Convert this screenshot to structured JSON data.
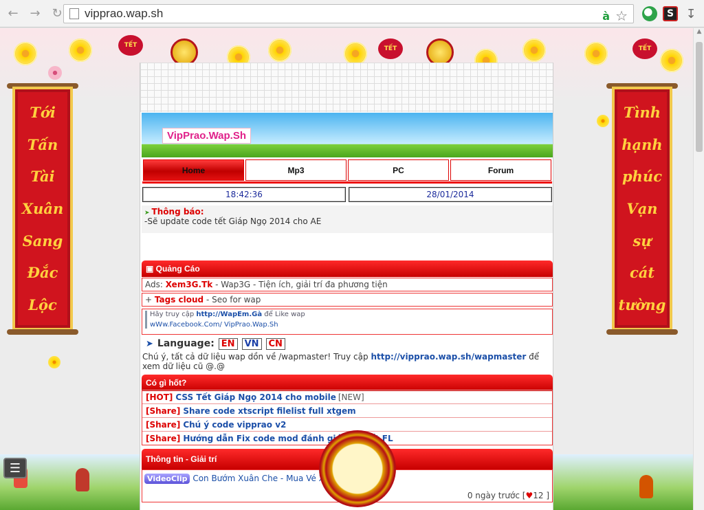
{
  "browser": {
    "url": "vipprao.wap.sh",
    "translate_icon": "à",
    "ext_badge": "S"
  },
  "banners": {
    "left": [
      "Tới",
      "Tấn",
      "Tài",
      "Xuân",
      "Sang",
      "Đắc",
      "Lộc"
    ],
    "right": [
      "Tình",
      "hạnh",
      "phúc",
      "Vạn",
      "sự",
      "cát",
      "tường"
    ]
  },
  "garland_badge": "TẾT",
  "site": {
    "logo": "VipPrao.Wap.Sh",
    "menu": [
      "Home",
      "Mp3",
      "PC",
      "Forum"
    ],
    "time": "18:42:36",
    "date": "28/01/2014",
    "notice": {
      "title": "Thông báo:",
      "text": "-Sẽ update code tết Giáp Ngọ 2014 cho AE"
    },
    "ads": {
      "heading": "Quảng Cáo",
      "prefix": "Ads:",
      "link": "Xem3G.Tk",
      "desc": "- Wap3G - Tiện ích, giải trí đa phương tiện"
    },
    "tags": {
      "prefix": "+",
      "label": "Tags cloud",
      "desc": "- Seo for wap"
    },
    "like": {
      "text1": "Hãy truy cập",
      "link": "http://WapEm.Gà",
      "text2": "để Like wap",
      "fb": "wWw.Facebook.Com/ VipPrao.Wap.Sh"
    },
    "language": {
      "label": "Language:",
      "options": [
        "EN",
        "VN",
        "CN"
      ]
    },
    "info": {
      "pre": "Chú ý, tất cả dữ liệu wap dồn về /wapmaster! Truy cập",
      "link": "http://vipprao.wap.sh/wapmaster",
      "post": "để xem dữ liệu cũ @.@"
    },
    "hot": {
      "heading": "Có gì hốt?",
      "items": [
        {
          "tag": "[HOT]",
          "title": "CSS Tết Giáp Ngọ 2014 cho mobile",
          "extra": "[NEW]"
        },
        {
          "tag": "[Share]",
          "title": "Share code xtscript filelist full xtgem",
          "extra": ""
        },
        {
          "tag": "[Share]",
          "title": "Chú ý code vipprao v2",
          "extra": ""
        },
        {
          "tag": "[Share]",
          "title": "Hướng dẫn Fix code mod đánh giá bài viết FL",
          "extra": ""
        }
      ]
    },
    "entertainment": {
      "heading": "Thông tin - Giải trí",
      "badge": "VideoClip",
      "title": "Con Bướm Xuân Che - Mua Vé Xe",
      "meta": "0 ngày trước",
      "likes": "12"
    }
  }
}
